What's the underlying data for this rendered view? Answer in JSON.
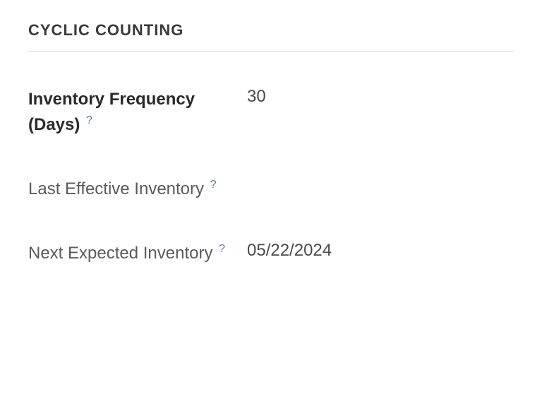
{
  "section": {
    "title": "CYCLIC COUNTING"
  },
  "fields": {
    "inventory_frequency": {
      "label": "Inventory Frequency (Days)",
      "value": "30",
      "help": "?"
    },
    "last_effective_inventory": {
      "label": "Last Effective Inventory",
      "value": "",
      "help": "?"
    },
    "next_expected_inventory": {
      "label": "Next Expected Inventory",
      "value": "05/22/2024",
      "help": "?"
    }
  }
}
